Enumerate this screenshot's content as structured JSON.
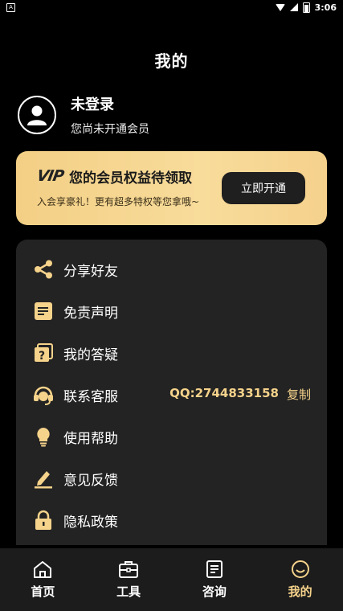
{
  "status_bar": {
    "time": "3:06"
  },
  "page": {
    "title": "我的"
  },
  "profile": {
    "name": "未登录",
    "subtitle": "您尚未开通会员"
  },
  "vip": {
    "logo": "VIP",
    "title": "您的会员权益待领取",
    "description": "入会享豪礼！更有超多特权等您拿哦~",
    "button_label": "立即开通"
  },
  "menu": {
    "items": [
      {
        "label": "分享好友",
        "icon": "share-icon"
      },
      {
        "label": "免责声明",
        "icon": "document-icon"
      },
      {
        "label": "我的答疑",
        "icon": "question-icon"
      },
      {
        "label": "联系客服",
        "icon": "headset-icon",
        "qq": "QQ:2744833158",
        "action": "复制"
      },
      {
        "label": "使用帮助",
        "icon": "lightbulb-icon"
      },
      {
        "label": "意见反馈",
        "icon": "pencil-icon"
      },
      {
        "label": "隐私政策",
        "icon": "lock-icon"
      }
    ]
  },
  "tabs": [
    {
      "label": "首页",
      "icon": "home-icon"
    },
    {
      "label": "工具",
      "icon": "toolbox-icon"
    },
    {
      "label": "咨询",
      "icon": "notes-icon"
    },
    {
      "label": "我的",
      "icon": "smile-icon",
      "active": true
    }
  ],
  "colors": {
    "accent": "#f6d38b",
    "card_bg": "#232323",
    "background": "#000000",
    "tabbar_bg": "#1c1c1c"
  }
}
